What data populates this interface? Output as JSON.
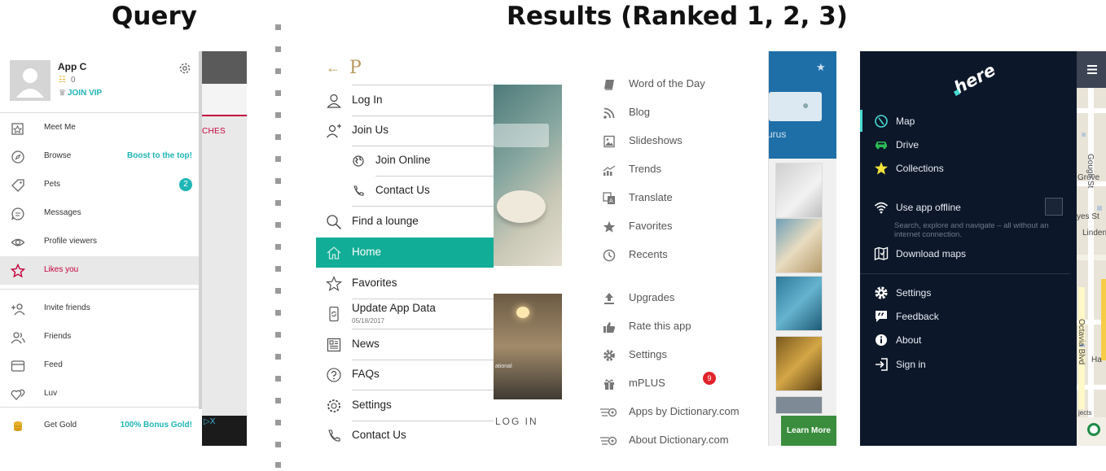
{
  "headings": {
    "query": "Query",
    "results": "Results (Ranked 1, 2, 3)"
  },
  "query": {
    "behind_tab": "CHES",
    "ad_marker": "▷X",
    "profile": {
      "name": "App C",
      "coins": "0",
      "vip": "JOIN VIP"
    },
    "items": [
      {
        "label": "Meet Me",
        "icon": "meet-me-icon"
      },
      {
        "label": "Browse",
        "icon": "compass-icon",
        "promo": "Boost to the top!"
      },
      {
        "label": "Pets",
        "icon": "tag-icon",
        "badge": "2"
      },
      {
        "label": "Messages",
        "icon": "chat-icon"
      },
      {
        "label": "Profile viewers",
        "icon": "eye-icon"
      },
      {
        "label": "Likes you",
        "icon": "star-icon"
      },
      {
        "label": "Invite friends",
        "icon": "add-person-icon"
      },
      {
        "label": "Friends",
        "icon": "friends-icon"
      },
      {
        "label": "Feed",
        "icon": "feed-icon"
      },
      {
        "label": "Luv",
        "icon": "hearts-icon"
      },
      {
        "label": "Get Gold",
        "icon": "gold-coins-icon",
        "promo": "100% Bonus Gold!"
      }
    ],
    "accent_color": "#1fb5b5",
    "active_color": "#c3003c"
  },
  "result1": {
    "logo": "P",
    "items": [
      {
        "label": "Log In",
        "icon": "person-icon"
      },
      {
        "label": "Join Us",
        "icon": "add-person-icon"
      },
      {
        "label": "Join Online",
        "icon": "globe-icon"
      },
      {
        "label": "Contact Us",
        "icon": "phone-icon"
      },
      {
        "label": "Find a lounge",
        "icon": "search-icon"
      },
      {
        "label": "Home",
        "icon": "home-icon"
      },
      {
        "label": "Favorites",
        "icon": "star-icon"
      },
      {
        "label": "Update App Data",
        "sub": "05/18/2017",
        "icon": "refresh-phone-icon"
      },
      {
        "label": "News",
        "icon": "news-icon"
      },
      {
        "label": "FAQs",
        "icon": "question-icon"
      },
      {
        "label": "Settings",
        "icon": "gear-icon"
      },
      {
        "label": "Contact Us",
        "icon": "phone-icon"
      }
    ],
    "photo_caption": "ational",
    "login_text": "LOG IN",
    "accent_color": "#12ad96",
    "brand_color": "#b79a5c"
  },
  "result2": {
    "side_text": "urus",
    "learn_more": "Learn More",
    "items": [
      {
        "label": "Word of the Day",
        "icon": "book-icon"
      },
      {
        "label": "Blog",
        "icon": "rss-icon"
      },
      {
        "label": "Slideshows",
        "icon": "image-icon"
      },
      {
        "label": "Trends",
        "icon": "trends-icon"
      },
      {
        "label": "Translate",
        "icon": "translate-icon"
      },
      {
        "label": "Favorites",
        "icon": "star-icon"
      },
      {
        "label": "Recents",
        "icon": "clock-icon"
      },
      {
        "label": "Upgrades",
        "icon": "upload-icon"
      },
      {
        "label": "Rate this app",
        "icon": "thumbs-up-icon"
      },
      {
        "label": "Settings",
        "icon": "gear-icon"
      },
      {
        "label": "mPLUS",
        "icon": "gift-icon",
        "badge": "9"
      },
      {
        "label": "Apps by Dictionary.com",
        "icon": "dictionary-logo-icon"
      },
      {
        "label": "About Dictionary.com",
        "icon": "dictionary-logo-icon"
      }
    ]
  },
  "result3": {
    "logo": "here",
    "items": [
      {
        "label": "Map",
        "icon": "map-compass-icon"
      },
      {
        "label": "Drive",
        "icon": "car-icon"
      },
      {
        "label": "Collections",
        "icon": "star-icon"
      },
      {
        "label": "Use app offline",
        "icon": "wifi-icon"
      },
      {
        "label": "Download maps",
        "icon": "download-map-icon"
      },
      {
        "label": "Settings",
        "icon": "gear-icon"
      },
      {
        "label": "Feedback",
        "icon": "feedback-icon"
      },
      {
        "label": "About",
        "icon": "info-icon"
      },
      {
        "label": "Sign in",
        "icon": "sign-in-icon"
      }
    ],
    "offline_description": "Search, explore and navigate – all without an internet connection.",
    "streets": [
      "Gough St",
      "Grove",
      "yes St",
      "Linden",
      "Octavia Blvd",
      "Ha",
      "jects"
    ],
    "accent_color": "#48dad0"
  }
}
